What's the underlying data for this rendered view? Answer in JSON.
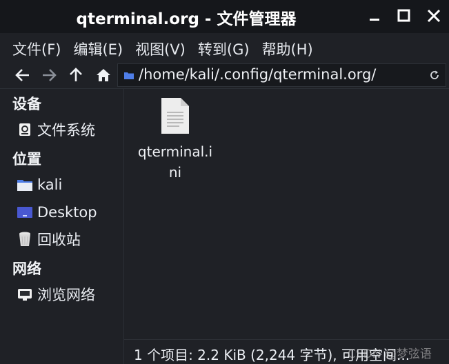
{
  "window": {
    "title": "qterminal.org - 文件管理器"
  },
  "menu": {
    "items": [
      {
        "label": "文件(F)"
      },
      {
        "label": "编辑(E)"
      },
      {
        "label": "视图(V)"
      },
      {
        "label": "转到(G)"
      },
      {
        "label": "帮助(H)"
      }
    ]
  },
  "toolbar": {
    "address": "/home/kali/.config/qterminal.org/"
  },
  "sidebar": {
    "devices_heading": "设备",
    "devices": [
      {
        "label": "文件系统",
        "icon": "drive-icon"
      }
    ],
    "places_heading": "位置",
    "places": [
      {
        "label": "kali",
        "icon": "home-folder-icon"
      },
      {
        "label": "Desktop",
        "icon": "desktop-icon"
      },
      {
        "label": "回收站",
        "icon": "trash-icon"
      }
    ],
    "network_heading": "网络",
    "network": [
      {
        "label": "浏览网络",
        "icon": "network-icon"
      }
    ]
  },
  "files": [
    {
      "name": "qterminal.ini",
      "icon": "text-file-icon"
    }
  ],
  "status": {
    "text": "1 个项目: 2.2 KiB (2,244 字节), 可用空间..."
  },
  "watermark": "CSDN @梦弦语",
  "colors": {
    "accent": "#4f7ee8",
    "background": "#1f2126",
    "titlebar": "#15171b"
  }
}
